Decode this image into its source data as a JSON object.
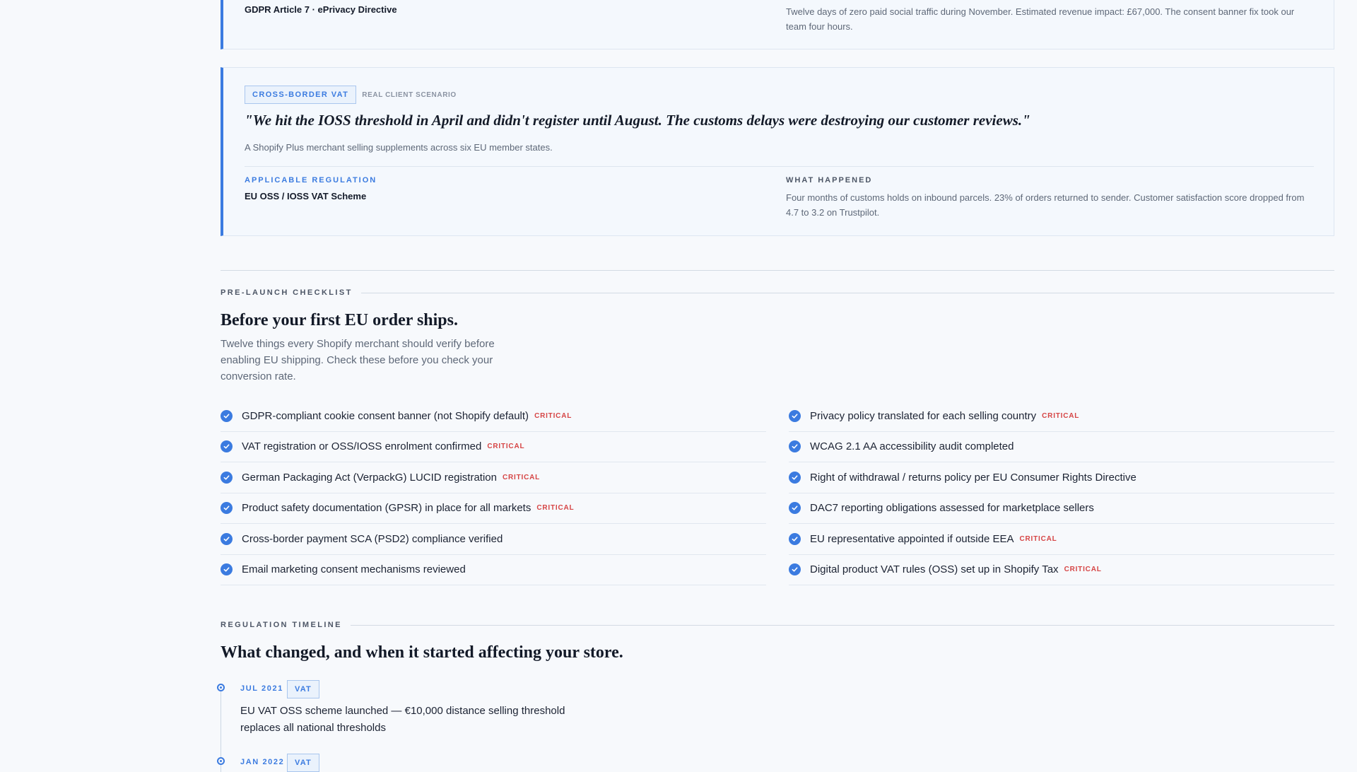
{
  "case_prev": {
    "regulation": "GDPR Article 7 · ePrivacy Directive",
    "what_happened": "Twelve days of zero paid social traffic during November. Estimated revenue impact: £67,000. The consent banner fix took our team four hours."
  },
  "case_main": {
    "tag": "CROSS-BORDER VAT",
    "tag_note": "REAL CLIENT SCENARIO",
    "quote": "\"We hit the IOSS threshold in April and didn't register until August. The customs delays were destroying our customer reviews.\"",
    "description": "A Shopify Plus merchant selling supplements across six EU member states.",
    "regulation_label": "APPLICABLE REGULATION",
    "regulation": "EU OSS / IOSS VAT Scheme",
    "what_label": "WHAT HAPPENED",
    "what_happened": "Four months of customs holds on inbound parcels. 23% of orders returned to sender. Customer satisfaction score dropped from 4.7 to 3.2 on Trustpilot."
  },
  "checklist": {
    "eyebrow": "PRE-LAUNCH CHECKLIST",
    "title": "Before your first EU order ships.",
    "subtitle": "Twelve things every Shopify merchant should verify before enabling EU shipping. Check these before you check your conversion rate.",
    "critical_label": "CRITICAL",
    "left": [
      {
        "text": "GDPR-compliant cookie consent banner (not Shopify default)",
        "critical": true
      },
      {
        "text": "VAT registration or OSS/IOSS enrolment confirmed",
        "critical": true
      },
      {
        "text": "German Packaging Act (VerpackG) LUCID registration",
        "critical": true
      },
      {
        "text": "Product safety documentation (GPSR) in place for all markets",
        "critical": true
      },
      {
        "text": "Cross-border payment SCA (PSD2) compliance verified",
        "critical": false
      },
      {
        "text": "Email marketing consent mechanisms reviewed",
        "critical": false
      }
    ],
    "right": [
      {
        "text": "Privacy policy translated for each selling country",
        "critical": true
      },
      {
        "text": "WCAG 2.1 AA accessibility audit completed",
        "critical": false
      },
      {
        "text": "Right of withdrawal / returns policy per EU Consumer Rights Directive",
        "critical": false
      },
      {
        "text": "DAC7 reporting obligations assessed for marketplace sellers",
        "critical": false
      },
      {
        "text": "EU representative appointed if outside EEA",
        "critical": true
      },
      {
        "text": "Digital product VAT rules (OSS) set up in Shopify Tax",
        "critical": true
      }
    ]
  },
  "timeline": {
    "eyebrow": "REGULATION TIMELINE",
    "title": "What changed, and when it started affecting your store.",
    "entries": [
      {
        "date": "JUL 2021",
        "tag": "VAT",
        "text": "EU VAT OSS scheme launched — €10,000 distance selling threshold replaces all national thresholds"
      },
      {
        "date": "JAN 2022",
        "tag": "VAT",
        "text": ""
      }
    ]
  },
  "colors": {
    "accent": "#3b7be0",
    "critical": "#d64545",
    "background": "#f7f9fc"
  }
}
